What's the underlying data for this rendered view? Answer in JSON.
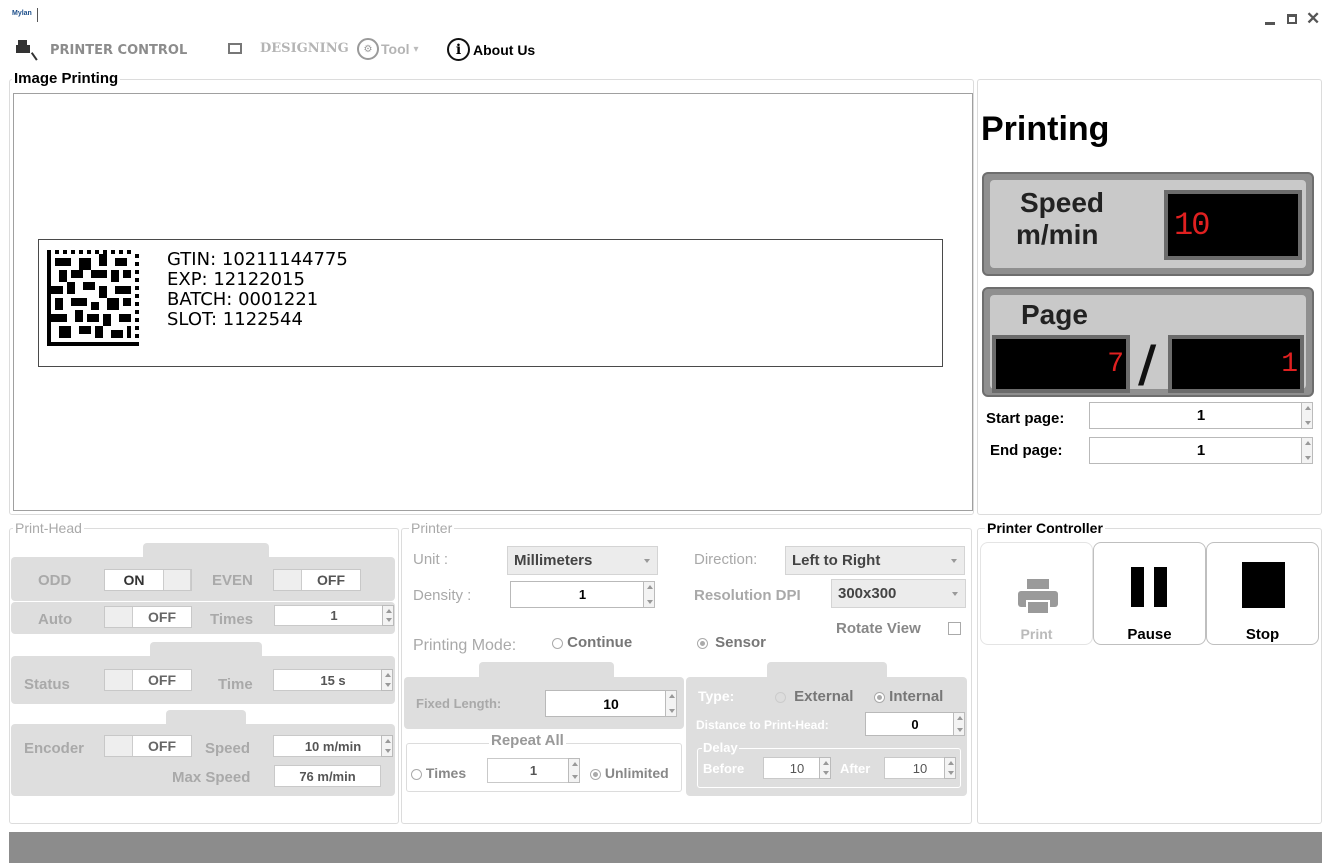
{
  "app": {
    "logo": "Mylan"
  },
  "window_controls": [
    "minimize",
    "maximize",
    "close"
  ],
  "menu": {
    "printer_control": "PRINTER CONTROL",
    "designing": "DESIGNING",
    "tool": "Tool",
    "about": "About Us"
  },
  "image_printing": {
    "title": "Image Printing",
    "label_lines": [
      "GTIN: 10211144775",
      "EXP: 12122015",
      "BATCH: 0001221",
      "SLOT: 1122544"
    ]
  },
  "printing": {
    "title": "Printing",
    "speed_label_1": "Speed",
    "speed_label_2": "m/min",
    "speed_value": "10",
    "page_label": "Page",
    "page_current": "7",
    "page_sep": "/",
    "page_total": "1",
    "start_page_label": "Start page:",
    "start_page_value": "1",
    "end_page_label": "End page:",
    "end_page_value": "1"
  },
  "print_head": {
    "title": "Print-Head",
    "odd": "ODD",
    "odd_state": "ON",
    "even": "EVEN",
    "even_state": "OFF",
    "auto": "Auto",
    "auto_state": "OFF",
    "times_label": "Times",
    "times_value": "1",
    "status": "Status",
    "status_state": "OFF",
    "time_label": "Time",
    "time_value": "15 s",
    "encoder": "Encoder",
    "encoder_state": "OFF",
    "speed_label": "Speed",
    "speed_value": "10 m/min",
    "max_speed_label": "Max Speed",
    "max_speed_value": "76 m/min"
  },
  "printer": {
    "title": "Printer",
    "unit_label": "Unit :",
    "unit_value": "Millimeters",
    "direction_label": "Direction:",
    "direction_value": "Left to Right",
    "density_label": "Density :",
    "density_value": "1",
    "resolution_label": "Resolution DPI",
    "resolution_value": "300x300",
    "rotate_label": "Rotate View",
    "mode_label": "Printing Mode:",
    "mode_continue": "Continue",
    "mode_sensor": "Sensor",
    "fixed_length_label": "Fixed Length:",
    "fixed_length_value": "10",
    "repeat_all": "Repeat All",
    "times_label": "Times",
    "times_value": "1",
    "unlimited_label": "Unlimited",
    "type_label": "Type:",
    "type_external": "External",
    "type_internal": "Internal",
    "distance_label": "Distance to Print-Head:",
    "distance_value": "0",
    "delay_label": "Delay",
    "before_label": "Before",
    "before_value": "10",
    "after_label": "After",
    "after_value": "10"
  },
  "controller": {
    "title": "Printer Controller",
    "print": "Print",
    "pause": "Pause",
    "stop": "Stop"
  }
}
